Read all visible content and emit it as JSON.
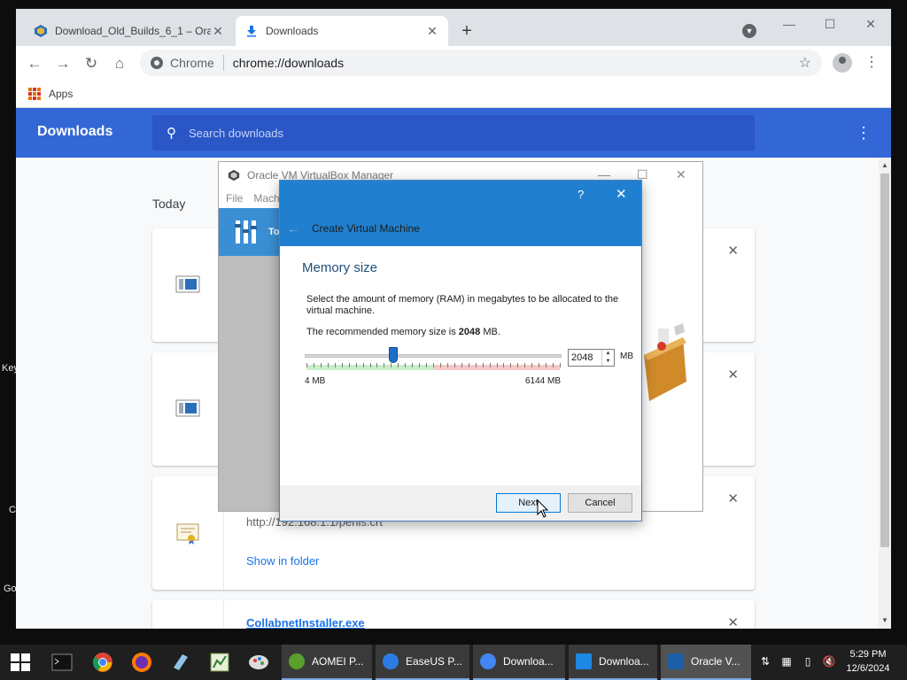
{
  "desktop": {
    "labels": [
      "Key",
      "C",
      "Go"
    ]
  },
  "chrome": {
    "tabs": [
      {
        "title": "Download_Old_Builds_6_1 – Orac",
        "active": false
      },
      {
        "title": "Downloads",
        "active": true
      }
    ],
    "new_tab": "+",
    "controls": {
      "minimize": "—",
      "maximize": "☐",
      "close": "✕"
    },
    "omnibox": {
      "chip": "Chrome",
      "url": "chrome://downloads"
    },
    "bookmarks": {
      "apps_label": "Apps"
    }
  },
  "downloads": {
    "title": "Downloads",
    "search_placeholder": "Search downloads",
    "section_today": "Today",
    "items": [
      {
        "url": "http://192.168.1.1/pehis.crt",
        "action": "Show in folder"
      },
      {
        "filename": "CollabnetInstaller.exe"
      }
    ]
  },
  "vbox_manager": {
    "title": "Oracle VM VirtualBox Manager",
    "menu": [
      "File",
      "Mach"
    ],
    "tools_label": "To"
  },
  "dialog": {
    "header": "Create Virtual Machine",
    "help": "?",
    "close": "✕",
    "page_title": "Memory size",
    "description": "Select the amount of memory (RAM) in megabytes to be allocated to the virtual machine.",
    "recommended_prefix": "The recommended memory size is",
    "recommended_value": "2048",
    "recommended_suffix": "MB.",
    "memory_value": "2048",
    "memory_fraction": 0.333,
    "min_label": "4 MB",
    "max_label": "6144 MB",
    "unit": "MB",
    "next_button": "Next",
    "cancel_button": "Cancel"
  },
  "taskbar": {
    "tasks": [
      {
        "label": "AOMEI P...",
        "color": "#5aa02c"
      },
      {
        "label": "EaseUS P...",
        "color": "#2d7be5"
      },
      {
        "label": "Downloa...",
        "color": "#4285f4"
      },
      {
        "label": "Downloa...",
        "color": "#1e88e5"
      },
      {
        "label": "Oracle V...",
        "color": "#1c5fa8"
      }
    ],
    "clock": {
      "time": "5:29 PM",
      "date": "12/6/2024"
    }
  },
  "colors": {
    "chrome_blue": "#3367d6",
    "dialog_blue": "#2080cf",
    "link": "#1a73e8"
  }
}
